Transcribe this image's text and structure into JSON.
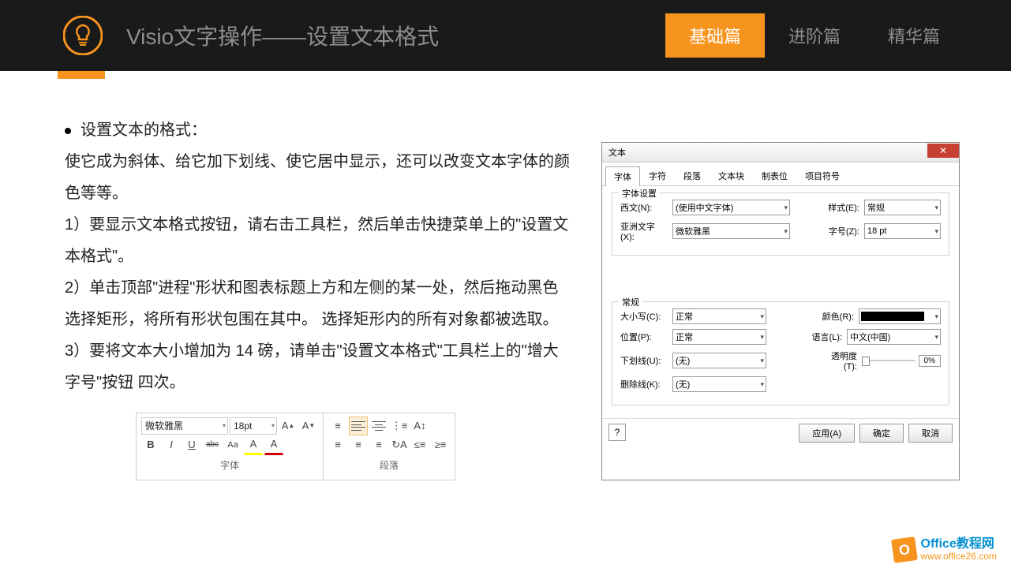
{
  "header": {
    "title": "Visio文字操作——设置文本格式",
    "tabs": [
      "基础篇",
      "进阶篇",
      "精华篇"
    ],
    "active_tab": 0
  },
  "content": {
    "heading": "设置文本的格式：",
    "para1": "使它成为斜体、给它加下划线、使它居中显示，还可以改变文本字体的颜色等等。",
    "step1": "1）要显示文本格式按钮，请右击工具栏，然后单击快捷菜单上的\"设置文本格式\"。",
    "step2": "2）单击顶部\"进程\"形状和图表标题上方和左侧的某一处，然后拖动黑色选择矩形，将所有形状包围在其中。 选择矩形内的所有对象都被选取。",
    "step3": "3）要将文本大小增加为 14 磅，请单击\"设置文本格式\"工具栏上的\"增大字号\"按钮 四次。"
  },
  "dialog": {
    "title": "文本",
    "tabs": [
      "字体",
      "字符",
      "段落",
      "文本块",
      "制表位",
      "项目符号"
    ],
    "active_tab": 0,
    "group1": "字体设置",
    "western_label": "西文(N):",
    "western_value": "(使用中文字体)",
    "style_label": "样式(E):",
    "style_value": "常规",
    "asian_label": "亚洲文字(X):",
    "asian_value": "微软雅黑",
    "size_label": "字号(Z):",
    "size_value": "18 pt",
    "group2": "常规",
    "case_label": "大小写(C):",
    "case_value": "正常",
    "color_label": "颜色(R):",
    "position_label": "位置(P):",
    "position_value": "正常",
    "lang_label": "语言(L):",
    "lang_value": "中文(中国)",
    "underline_label": "下划线(U):",
    "underline_value": "(无)",
    "trans_label": "透明度(T):",
    "trans_value": "0%",
    "strike_label": "删除线(K):",
    "strike_value": "(无)",
    "apply": "应用(A)",
    "ok": "确定",
    "cancel": "取消",
    "help": "?"
  },
  "toolbar": {
    "font": "微软雅黑",
    "size": "18pt",
    "group1_label": "字体",
    "group2_label": "段落",
    "buttons": {
      "bold": "B",
      "italic": "I",
      "underline": "U",
      "strike": "abc",
      "case": "Aa",
      "highlight": "A",
      "fontcolor": "A",
      "grow": "A↑",
      "shrink": "A↓"
    }
  },
  "footer": {
    "brand1": "Office",
    "brand2": "教程网",
    "url": "www.office26.com"
  }
}
